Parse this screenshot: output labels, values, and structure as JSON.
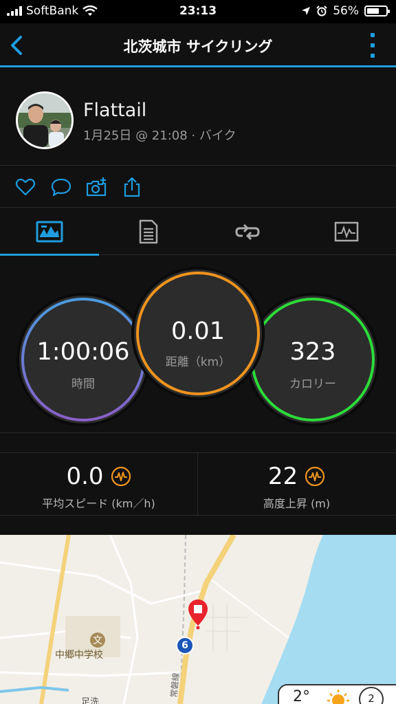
{
  "status_bar": {
    "carrier": "SoftBank",
    "time": "23:13",
    "battery": "56%",
    "battery_level": 0.56
  },
  "nav": {
    "title": "北茨城市 サイクリング",
    "back_icon": "chevron-left-icon",
    "more_icon": "more-vertical-icon",
    "accent": "#1e9de0"
  },
  "profile": {
    "name": "Flattail",
    "meta": "1月25日 @ 21:08 · バイク"
  },
  "actions": [
    {
      "name": "like-button",
      "icon": "heart-icon"
    },
    {
      "name": "comment-button",
      "icon": "comment-icon"
    },
    {
      "name": "add-photo-button",
      "icon": "camera-plus-icon"
    },
    {
      "name": "share-button",
      "icon": "share-icon"
    }
  ],
  "tabs": [
    {
      "name": "tab-overview",
      "icon": "overview-icon",
      "selected": true
    },
    {
      "name": "tab-details",
      "icon": "document-icon"
    },
    {
      "name": "tab-laps",
      "icon": "laps-icon"
    },
    {
      "name": "tab-charts",
      "icon": "chart-icon"
    }
  ],
  "rings": {
    "time": {
      "value": "1:00:06",
      "label": "時間",
      "colors": [
        "#4a9be0",
        "#8a5fc9"
      ]
    },
    "distance": {
      "value": "0.01",
      "label": "距離（km）",
      "color": "#f0941e"
    },
    "calories": {
      "value": "323",
      "label": "カロリー",
      "color": "#2bdc39"
    }
  },
  "stats": {
    "avg_speed": {
      "value": "0.0",
      "label": "平均スピード (km／h)"
    },
    "elevation_gain": {
      "value": "22",
      "label": "高度上昇 (m)"
    },
    "badge_color": "#f0941e"
  },
  "map": {
    "school_label": "中郷中学校",
    "place_label": "足洗",
    "route_number": "6",
    "road_label": "常磐線",
    "pin_color": "#e8232d",
    "sea_color": "#a5dcf2"
  },
  "weather": {
    "temp": "2°",
    "count": "2"
  }
}
